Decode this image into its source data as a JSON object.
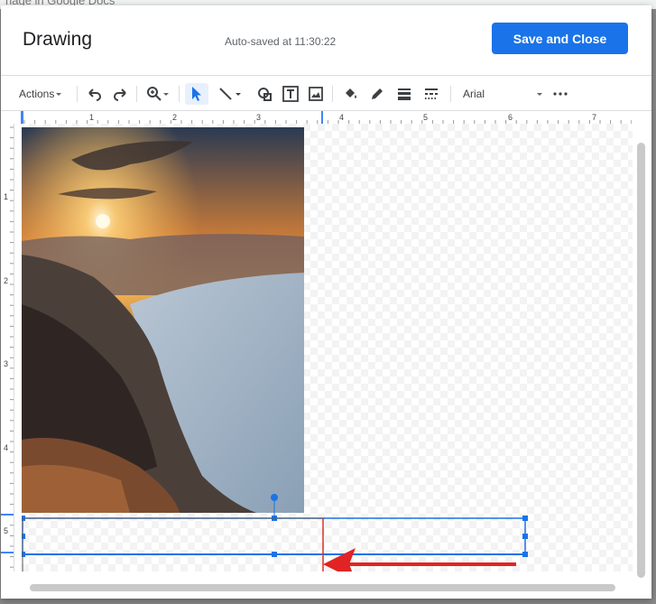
{
  "background": {
    "tab_text": "nage in Google Docs"
  },
  "dialog": {
    "title": "Drawing",
    "autosave": "Auto-saved at 11:30:22",
    "save_button": "Save and Close"
  },
  "toolbar": {
    "actions_label": "Actions",
    "font_name": "Arial",
    "icons": [
      "undo-icon",
      "redo-icon",
      "zoom-icon",
      "select-icon",
      "line-icon",
      "shape-icon",
      "textbox-icon",
      "image-icon",
      "fill-color-icon",
      "border-color-icon",
      "border-weight-icon",
      "border-dash-icon",
      "more-icon"
    ]
  },
  "ruler": {
    "horizontal": [
      "1",
      "2",
      "3",
      "4",
      "5",
      "6",
      "7"
    ],
    "vertical": [
      "1",
      "2",
      "3",
      "4",
      "5"
    ]
  },
  "colors": {
    "accent": "#1a73e8",
    "arrow": "#e02424",
    "guide": "#d93025"
  }
}
